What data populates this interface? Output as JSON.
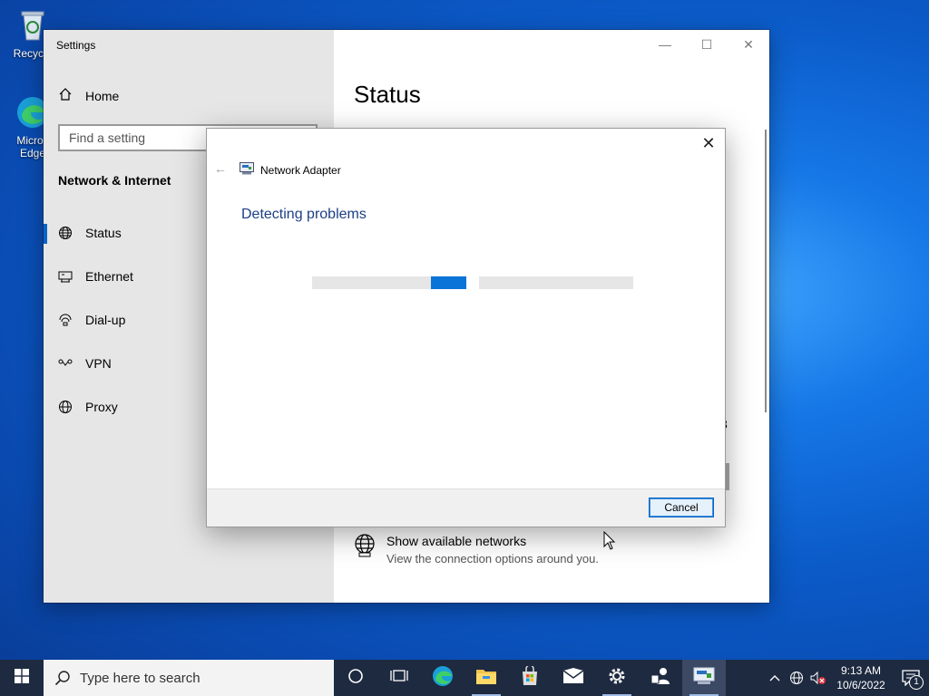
{
  "desktop": {
    "recycle_bin_label": "Recycle",
    "edge_label_line1": "Micros",
    "edge_label_line2": "Edge"
  },
  "settings": {
    "window_title": "Settings",
    "home_label": "Home",
    "search_placeholder": "Find a setting",
    "section_title": "Network & Internet",
    "nav": [
      {
        "label": "Status",
        "icon": "globe-status-icon",
        "selected": true
      },
      {
        "label": "Ethernet",
        "icon": "ethernet-icon"
      },
      {
        "label": "Dial-up",
        "icon": "dialup-icon"
      },
      {
        "label": "VPN",
        "icon": "vpn-icon"
      },
      {
        "label": "Proxy",
        "icon": "globe-icon"
      }
    ],
    "page_title": "Status",
    "peek_text": "3",
    "show_networks": {
      "title": "Show available networks",
      "subtitle": "View the connection options around you."
    }
  },
  "dialog": {
    "header": "Network Adapter",
    "status": "Detecting problems",
    "progress_mode": "indeterminate",
    "cancel_label": "Cancel"
  },
  "taskbar": {
    "search_placeholder": "Type here to search",
    "apps": [
      "cortana-icon",
      "task-view-icon",
      "edge-icon",
      "file-explorer-icon",
      "store-icon",
      "mail-icon",
      "settings-icon",
      "people-icon",
      "troubleshooter-icon"
    ],
    "time": "9:13 AM",
    "date": "10/6/2022",
    "notification_count": "1"
  },
  "colors": {
    "accent": "#0a74d8",
    "dialog_title_blue": "#1b3f86",
    "taskbar": "#1e2a40"
  }
}
